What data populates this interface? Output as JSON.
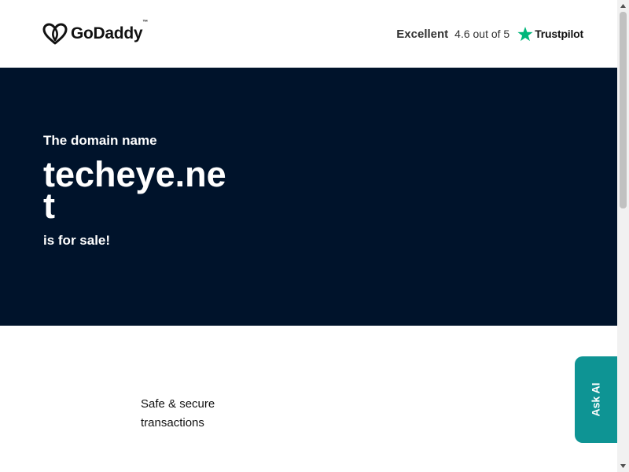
{
  "header": {
    "logo_text": "GoDaddy",
    "logo_tm": "™",
    "trust": {
      "rating_word": "Excellent",
      "score_text": "4.6 out of 5",
      "brand": "Trustpilot",
      "star_color": "#00b67a"
    }
  },
  "hero": {
    "kicker": "The domain name",
    "domain": "techeye.net",
    "sale_text": "is for sale!",
    "background": "#00132b"
  },
  "features": {
    "item_1": "Safe & secure transactions"
  },
  "ask_ai": {
    "label": "Ask AI",
    "color": "#0e9494"
  }
}
